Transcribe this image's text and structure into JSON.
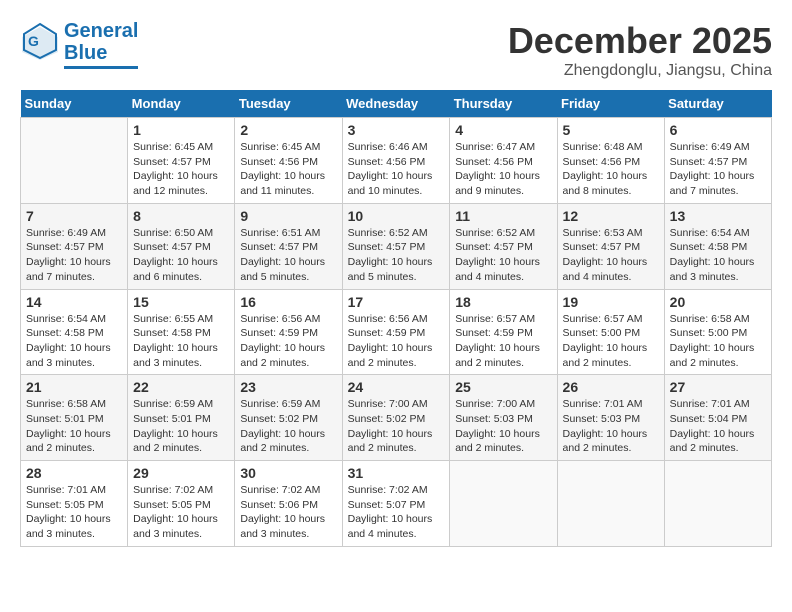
{
  "logo": {
    "line1": "General",
    "line2": "Blue"
  },
  "title": "December 2025",
  "location": "Zhengdonglu, Jiangsu, China",
  "days_of_week": [
    "Sunday",
    "Monday",
    "Tuesday",
    "Wednesday",
    "Thursday",
    "Friday",
    "Saturday"
  ],
  "weeks": [
    [
      {
        "day": "",
        "info": ""
      },
      {
        "day": "1",
        "info": "Sunrise: 6:45 AM\nSunset: 4:57 PM\nDaylight: 10 hours\nand 12 minutes."
      },
      {
        "day": "2",
        "info": "Sunrise: 6:45 AM\nSunset: 4:56 PM\nDaylight: 10 hours\nand 11 minutes."
      },
      {
        "day": "3",
        "info": "Sunrise: 6:46 AM\nSunset: 4:56 PM\nDaylight: 10 hours\nand 10 minutes."
      },
      {
        "day": "4",
        "info": "Sunrise: 6:47 AM\nSunset: 4:56 PM\nDaylight: 10 hours\nand 9 minutes."
      },
      {
        "day": "5",
        "info": "Sunrise: 6:48 AM\nSunset: 4:56 PM\nDaylight: 10 hours\nand 8 minutes."
      },
      {
        "day": "6",
        "info": "Sunrise: 6:49 AM\nSunset: 4:57 PM\nDaylight: 10 hours\nand 7 minutes."
      }
    ],
    [
      {
        "day": "7",
        "info": "Sunrise: 6:49 AM\nSunset: 4:57 PM\nDaylight: 10 hours\nand 7 minutes."
      },
      {
        "day": "8",
        "info": "Sunrise: 6:50 AM\nSunset: 4:57 PM\nDaylight: 10 hours\nand 6 minutes."
      },
      {
        "day": "9",
        "info": "Sunrise: 6:51 AM\nSunset: 4:57 PM\nDaylight: 10 hours\nand 5 minutes."
      },
      {
        "day": "10",
        "info": "Sunrise: 6:52 AM\nSunset: 4:57 PM\nDaylight: 10 hours\nand 5 minutes."
      },
      {
        "day": "11",
        "info": "Sunrise: 6:52 AM\nSunset: 4:57 PM\nDaylight: 10 hours\nand 4 minutes."
      },
      {
        "day": "12",
        "info": "Sunrise: 6:53 AM\nSunset: 4:57 PM\nDaylight: 10 hours\nand 4 minutes."
      },
      {
        "day": "13",
        "info": "Sunrise: 6:54 AM\nSunset: 4:58 PM\nDaylight: 10 hours\nand 3 minutes."
      }
    ],
    [
      {
        "day": "14",
        "info": "Sunrise: 6:54 AM\nSunset: 4:58 PM\nDaylight: 10 hours\nand 3 minutes."
      },
      {
        "day": "15",
        "info": "Sunrise: 6:55 AM\nSunset: 4:58 PM\nDaylight: 10 hours\nand 3 minutes."
      },
      {
        "day": "16",
        "info": "Sunrise: 6:56 AM\nSunset: 4:59 PM\nDaylight: 10 hours\nand 2 minutes."
      },
      {
        "day": "17",
        "info": "Sunrise: 6:56 AM\nSunset: 4:59 PM\nDaylight: 10 hours\nand 2 minutes."
      },
      {
        "day": "18",
        "info": "Sunrise: 6:57 AM\nSunset: 4:59 PM\nDaylight: 10 hours\nand 2 minutes."
      },
      {
        "day": "19",
        "info": "Sunrise: 6:57 AM\nSunset: 5:00 PM\nDaylight: 10 hours\nand 2 minutes."
      },
      {
        "day": "20",
        "info": "Sunrise: 6:58 AM\nSunset: 5:00 PM\nDaylight: 10 hours\nand 2 minutes."
      }
    ],
    [
      {
        "day": "21",
        "info": "Sunrise: 6:58 AM\nSunset: 5:01 PM\nDaylight: 10 hours\nand 2 minutes."
      },
      {
        "day": "22",
        "info": "Sunrise: 6:59 AM\nSunset: 5:01 PM\nDaylight: 10 hours\nand 2 minutes."
      },
      {
        "day": "23",
        "info": "Sunrise: 6:59 AM\nSunset: 5:02 PM\nDaylight: 10 hours\nand 2 minutes."
      },
      {
        "day": "24",
        "info": "Sunrise: 7:00 AM\nSunset: 5:02 PM\nDaylight: 10 hours\nand 2 minutes."
      },
      {
        "day": "25",
        "info": "Sunrise: 7:00 AM\nSunset: 5:03 PM\nDaylight: 10 hours\nand 2 minutes."
      },
      {
        "day": "26",
        "info": "Sunrise: 7:01 AM\nSunset: 5:03 PM\nDaylight: 10 hours\nand 2 minutes."
      },
      {
        "day": "27",
        "info": "Sunrise: 7:01 AM\nSunset: 5:04 PM\nDaylight: 10 hours\nand 2 minutes."
      }
    ],
    [
      {
        "day": "28",
        "info": "Sunrise: 7:01 AM\nSunset: 5:05 PM\nDaylight: 10 hours\nand 3 minutes."
      },
      {
        "day": "29",
        "info": "Sunrise: 7:02 AM\nSunset: 5:05 PM\nDaylight: 10 hours\nand 3 minutes."
      },
      {
        "day": "30",
        "info": "Sunrise: 7:02 AM\nSunset: 5:06 PM\nDaylight: 10 hours\nand 3 minutes."
      },
      {
        "day": "31",
        "info": "Sunrise: 7:02 AM\nSunset: 5:07 PM\nDaylight: 10 hours\nand 4 minutes."
      },
      {
        "day": "",
        "info": ""
      },
      {
        "day": "",
        "info": ""
      },
      {
        "day": "",
        "info": ""
      }
    ]
  ]
}
